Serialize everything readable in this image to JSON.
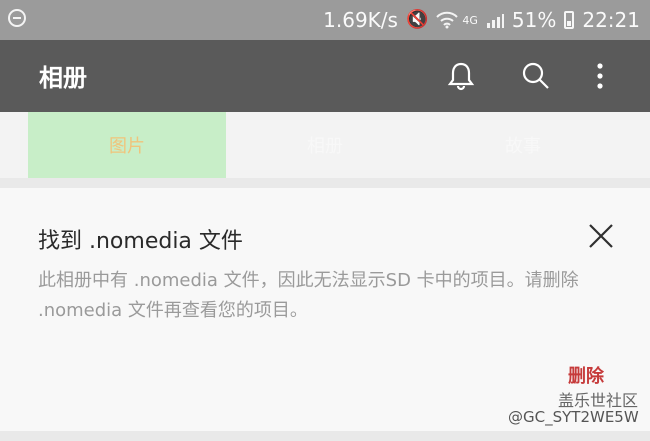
{
  "status_bar": {
    "net_speed": "1.69K/s",
    "signal_type": "4G",
    "battery_percent": "51%",
    "time": "22:21",
    "icons": [
      "minus-circle-icon",
      "mute-icon",
      "wifi-icon",
      "signal-icon",
      "battery-icon"
    ]
  },
  "app_bar": {
    "title": "相册",
    "actions": [
      "bell-icon",
      "search-icon",
      "more-vert-icon"
    ]
  },
  "tabs": [
    {
      "label": "图片",
      "selected": true
    },
    {
      "label": "相册",
      "selected": false
    },
    {
      "label": "故事",
      "selected": false
    }
  ],
  "dialog": {
    "title": "找到 .nomedia 文件",
    "message": "此相册中有 .nomedia 文件，因此无法显示SD 卡中的项目。请删除 .nomedia 文件再查看您的项目。",
    "delete_label": "删除"
  },
  "watermark": {
    "logo_text": "盖乐世社区",
    "user": "@GC_SYT2WE5W"
  },
  "colors": {
    "status_bg": "#9b9b9b",
    "app_bar_bg": "#5a5a5a",
    "tab_selected_bg": "#c8eec8",
    "tab_selected_text": "#f0c47b",
    "delete_text": "#c63b3b"
  }
}
